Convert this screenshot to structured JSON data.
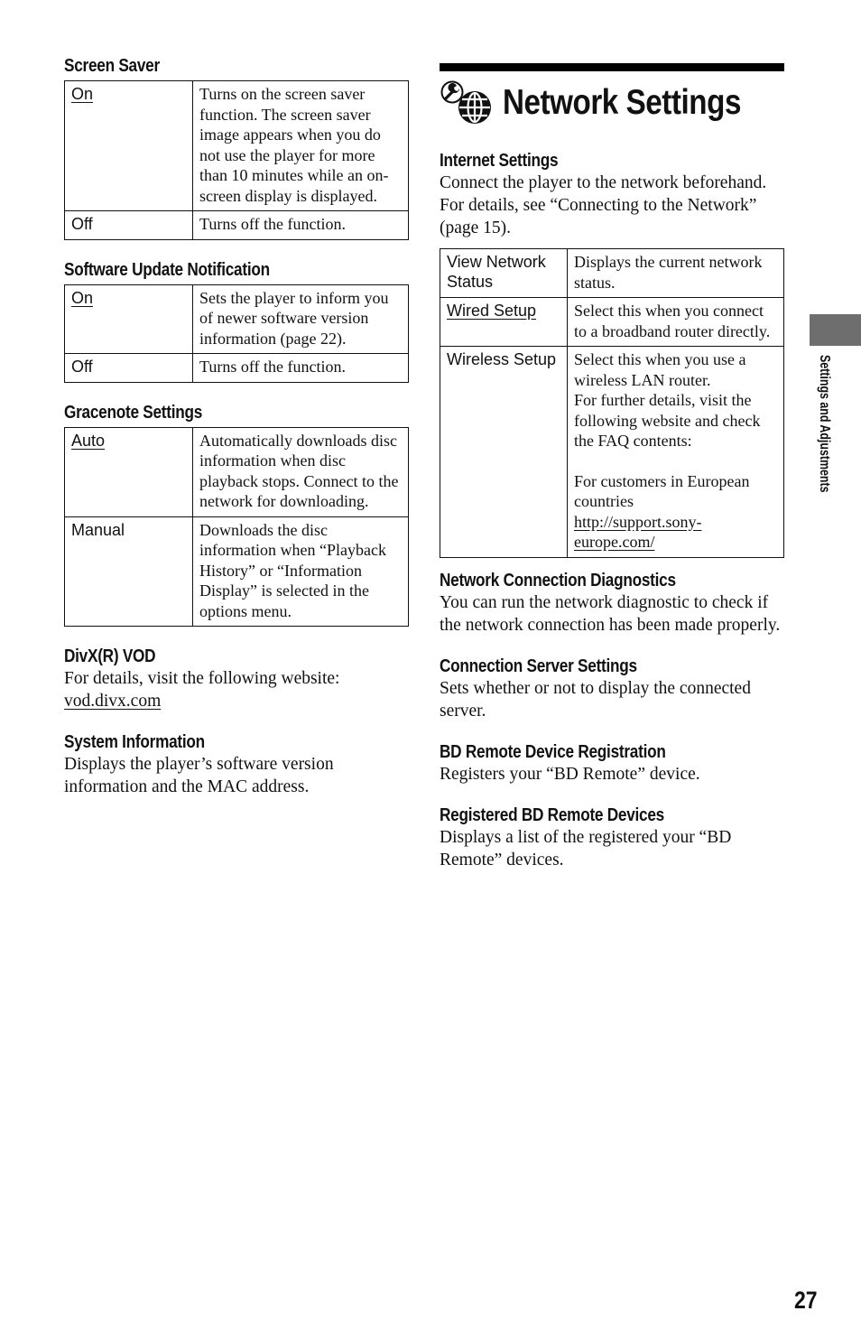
{
  "left_column": {
    "screen_saver": {
      "heading": "Screen Saver",
      "rows": [
        {
          "option": "On",
          "default": true,
          "description": "Turns on the screen saver function. The screen saver image appears when you do not use the player for more than 10 minutes while an on-screen display is displayed."
        },
        {
          "option": "Off",
          "default": false,
          "description": "Turns off the function."
        }
      ]
    },
    "software_update": {
      "heading": "Software Update Notification",
      "rows": [
        {
          "option": "On",
          "default": true,
          "description": "Sets the player to inform you of newer software version information (page 22)."
        },
        {
          "option": "Off",
          "default": false,
          "description": "Turns off the function."
        }
      ]
    },
    "gracenote": {
      "heading": "Gracenote Settings",
      "rows": [
        {
          "option": "Auto",
          "default": true,
          "description": "Automatically downloads disc information when disc playback stops. Connect to the network for downloading."
        },
        {
          "option": "Manual",
          "default": false,
          "description": "Downloads the disc information when “Playback History” or “Information Display” is selected in the options menu."
        }
      ]
    },
    "divx": {
      "heading": "DivX(R) VOD",
      "text": "For details, visit the following website:",
      "link": "vod.divx.com"
    },
    "system_info": {
      "heading": "System Information",
      "text": "Displays the player’s software version information and the MAC address."
    }
  },
  "right_column": {
    "title": "Network Settings",
    "title_icons": [
      "wrench-icon",
      "globe-icon"
    ],
    "internet_settings": {
      "heading": "Internet Settings",
      "text": "Connect the player to the network beforehand. For details, see “Connecting to the Network” (page 15).",
      "rows": [
        {
          "option": "View Network Status",
          "default": false,
          "description": "Displays the current network status."
        },
        {
          "option": "Wired Setup",
          "default": true,
          "description": "Select this when you connect to a broadband router directly."
        },
        {
          "option": "Wireless Setup",
          "default": false,
          "description": "Select this when you use a wireless LAN router.",
          "description_2": "For further details, visit the following website and check the FAQ contents:",
          "description_3": "For customers in European countries",
          "link": "http://support.sony-europe.com/"
        }
      ]
    },
    "diagnostics": {
      "heading": "Network Connection Diagnostics",
      "text": "You can run the network diagnostic to check if the network connection has been made properly."
    },
    "connection_server": {
      "heading": "Connection Server Settings",
      "text": "Sets whether or not to display the connected server."
    },
    "bd_remote_registration": {
      "heading": "BD Remote Device Registration",
      "text": "Registers your “BD Remote” device."
    },
    "registered_bd_remote": {
      "heading": "Registered BD Remote Devices",
      "text": "Displays a list of the registered your “BD Remote” devices."
    }
  },
  "side_tab": {
    "label": "Settings and Adjustments",
    "color": "#6e6e6e"
  },
  "page_number": "27"
}
